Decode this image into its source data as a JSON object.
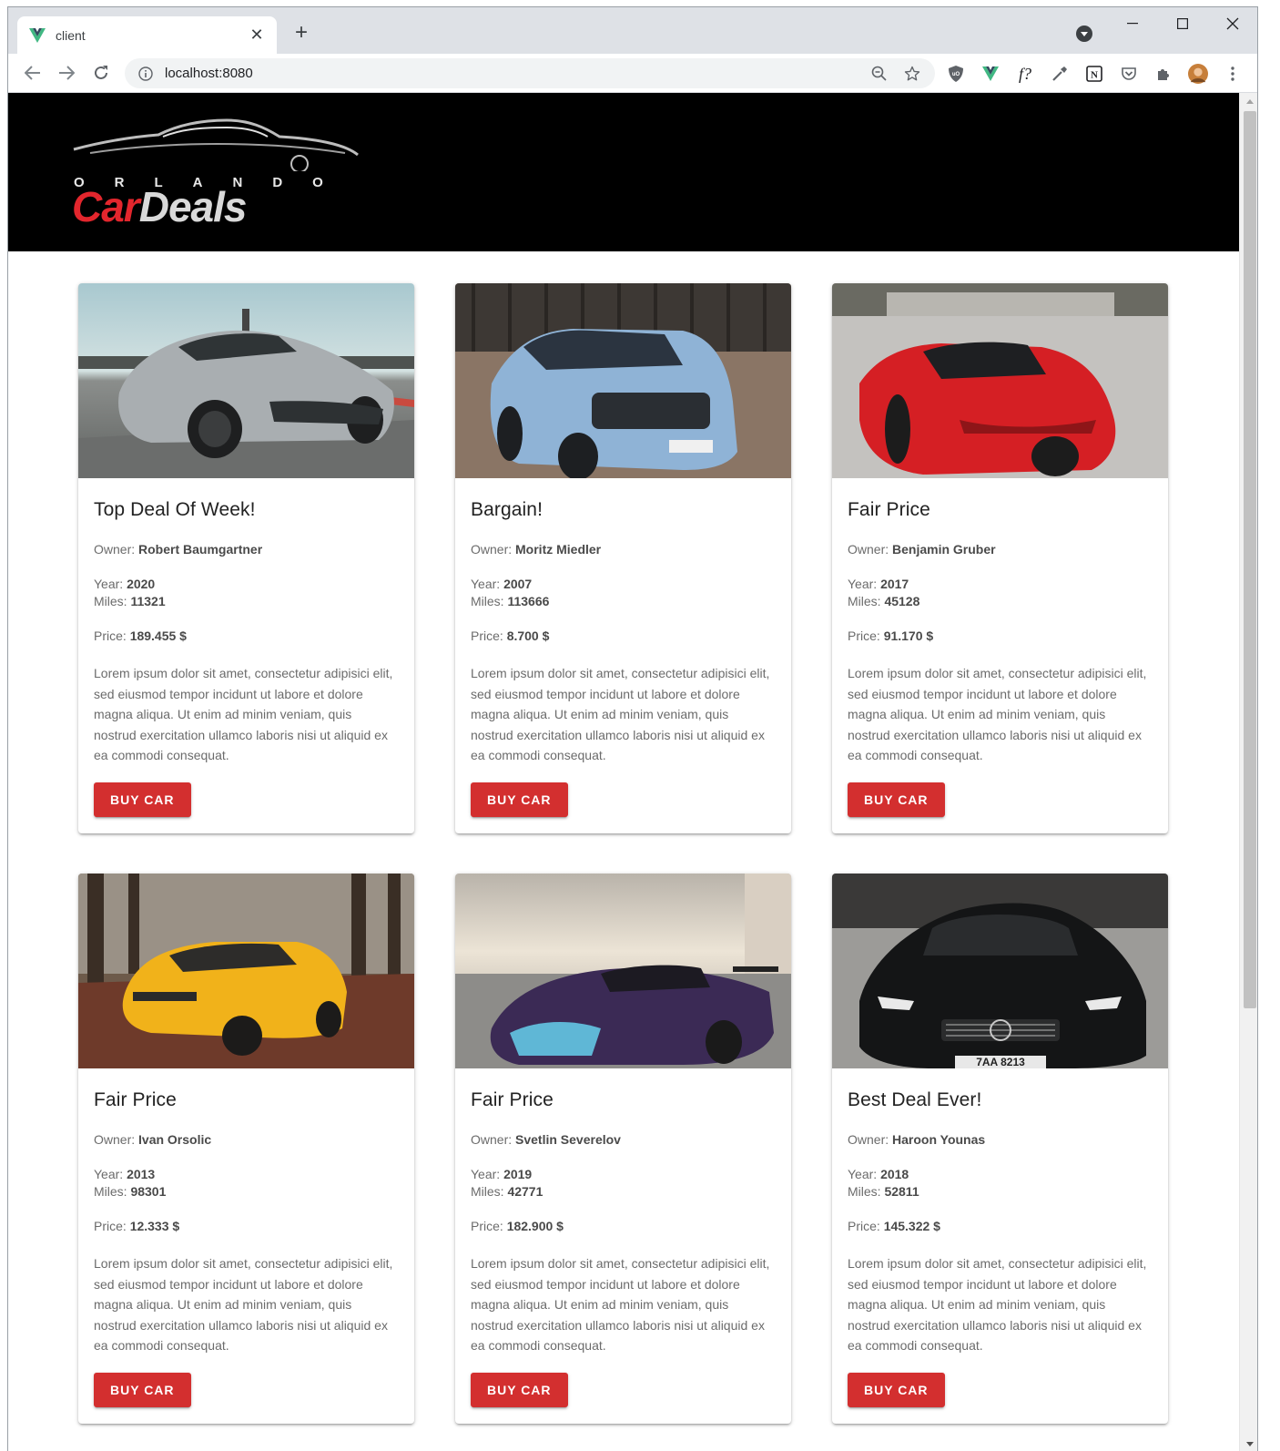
{
  "browser": {
    "tab_title": "client",
    "url": "localhost:8080"
  },
  "icons": {
    "favicon": "vue-logo-icon",
    "back": "arrow-left-icon",
    "forward": "arrow-right-icon",
    "reload": "reload-icon",
    "info": "info-icon",
    "zoom": "zoom-out-icon",
    "bookmark": "star-icon",
    "extensions": [
      "ublock-icon",
      "vue-devtools-icon",
      "font-finder-icon",
      "eyedropper-icon",
      "notion-icon",
      "pocket-icon",
      "puzzle-icon",
      "profile-avatar-icon",
      "menu-dots-icon"
    ]
  },
  "brand": {
    "logo_top": "ORLANDO",
    "logo_car": "Car",
    "logo_deals": "Deals",
    "accent_color": "#d32f2f"
  },
  "labels": {
    "owner": "Owner:",
    "year": "Year:",
    "miles": "Miles:",
    "price": "Price:"
  },
  "cars": [
    {
      "title": "Top Deal Of Week!",
      "owner": "Robert Baumgartner",
      "year": "2020",
      "miles": "11321",
      "price": "189.455 $",
      "description": "Lorem ipsum dolor sit amet, consectetur adipisici elit, sed eiusmod tempor incidunt ut labore et dolore magna aliqua. Ut enim ad minim veniam, quis nostrud exercitation ullamco laboris nisi ut aliquid ex ea commodi consequat.",
      "button": "BUY CAR",
      "photo": "silver sports car on track"
    },
    {
      "title": "Bargain!",
      "owner": "Moritz Miedler",
      "year": "2007",
      "miles": "113666",
      "price": "8.700 $",
      "description": "Lorem ipsum dolor sit amet, consectetur adipisici elit, sed eiusmod tempor incidunt ut labore et dolore magna aliqua. Ut enim ad minim veniam, quis nostrud exercitation ullamco laboris nisi ut aliquid ex ea commodi consequat.",
      "button": "BUY CAR",
      "photo": "light blue hatchback"
    },
    {
      "title": "Fair Price",
      "owner": "Benjamin Gruber",
      "year": "2017",
      "miles": "45128",
      "price": "91.170 $",
      "description": "Lorem ipsum dolor sit amet, consectetur adipisici elit, sed eiusmod tempor incidunt ut labore et dolore magna aliqua. Ut enim ad minim veniam, quis nostrud exercitation ullamco laboris nisi ut aliquid ex ea commodi consequat.",
      "button": "BUY CAR",
      "photo": "red sports car"
    },
    {
      "title": "Fair Price",
      "owner": "Ivan Orsolic",
      "year": "2013",
      "miles": "98301",
      "price": "12.333 $",
      "description": "Lorem ipsum dolor sit amet, consectetur adipisici elit, sed eiusmod tempor incidunt ut labore et dolore magna aliqua. Ut enim ad minim veniam, quis nostrud exercitation ullamco laboris nisi ut aliquid ex ea commodi consequat.",
      "button": "BUY CAR",
      "photo": "yellow hatchback in forest"
    },
    {
      "title": "Fair Price",
      "owner": "Svetlin Severelov",
      "year": "2019",
      "miles": "42771",
      "price": "182.900 $",
      "description": "Lorem ipsum dolor sit amet, consectetur adipisici elit, sed eiusmod tempor incidunt ut labore et dolore magna aliqua. Ut enim ad minim veniam, quis nostrud exercitation ullamco laboris nisi ut aliquid ex ea commodi consequat.",
      "button": "BUY CAR",
      "photo": "purple sports car"
    },
    {
      "title": "Best Deal Ever!",
      "owner": "Haroon Younas",
      "year": "2018",
      "miles": "52811",
      "price": "145.322 $",
      "description": "Lorem ipsum dolor sit amet, consectetur adipisici elit, sed eiusmod tempor incidunt ut labore et dolore magna aliqua. Ut enim ad minim veniam, quis nostrud exercitation ullamco laboris nisi ut aliquid ex ea commodi consequat.",
      "button": "BUY CAR",
      "photo": "black sedan front view",
      "plate": "7AA 8213"
    }
  ]
}
